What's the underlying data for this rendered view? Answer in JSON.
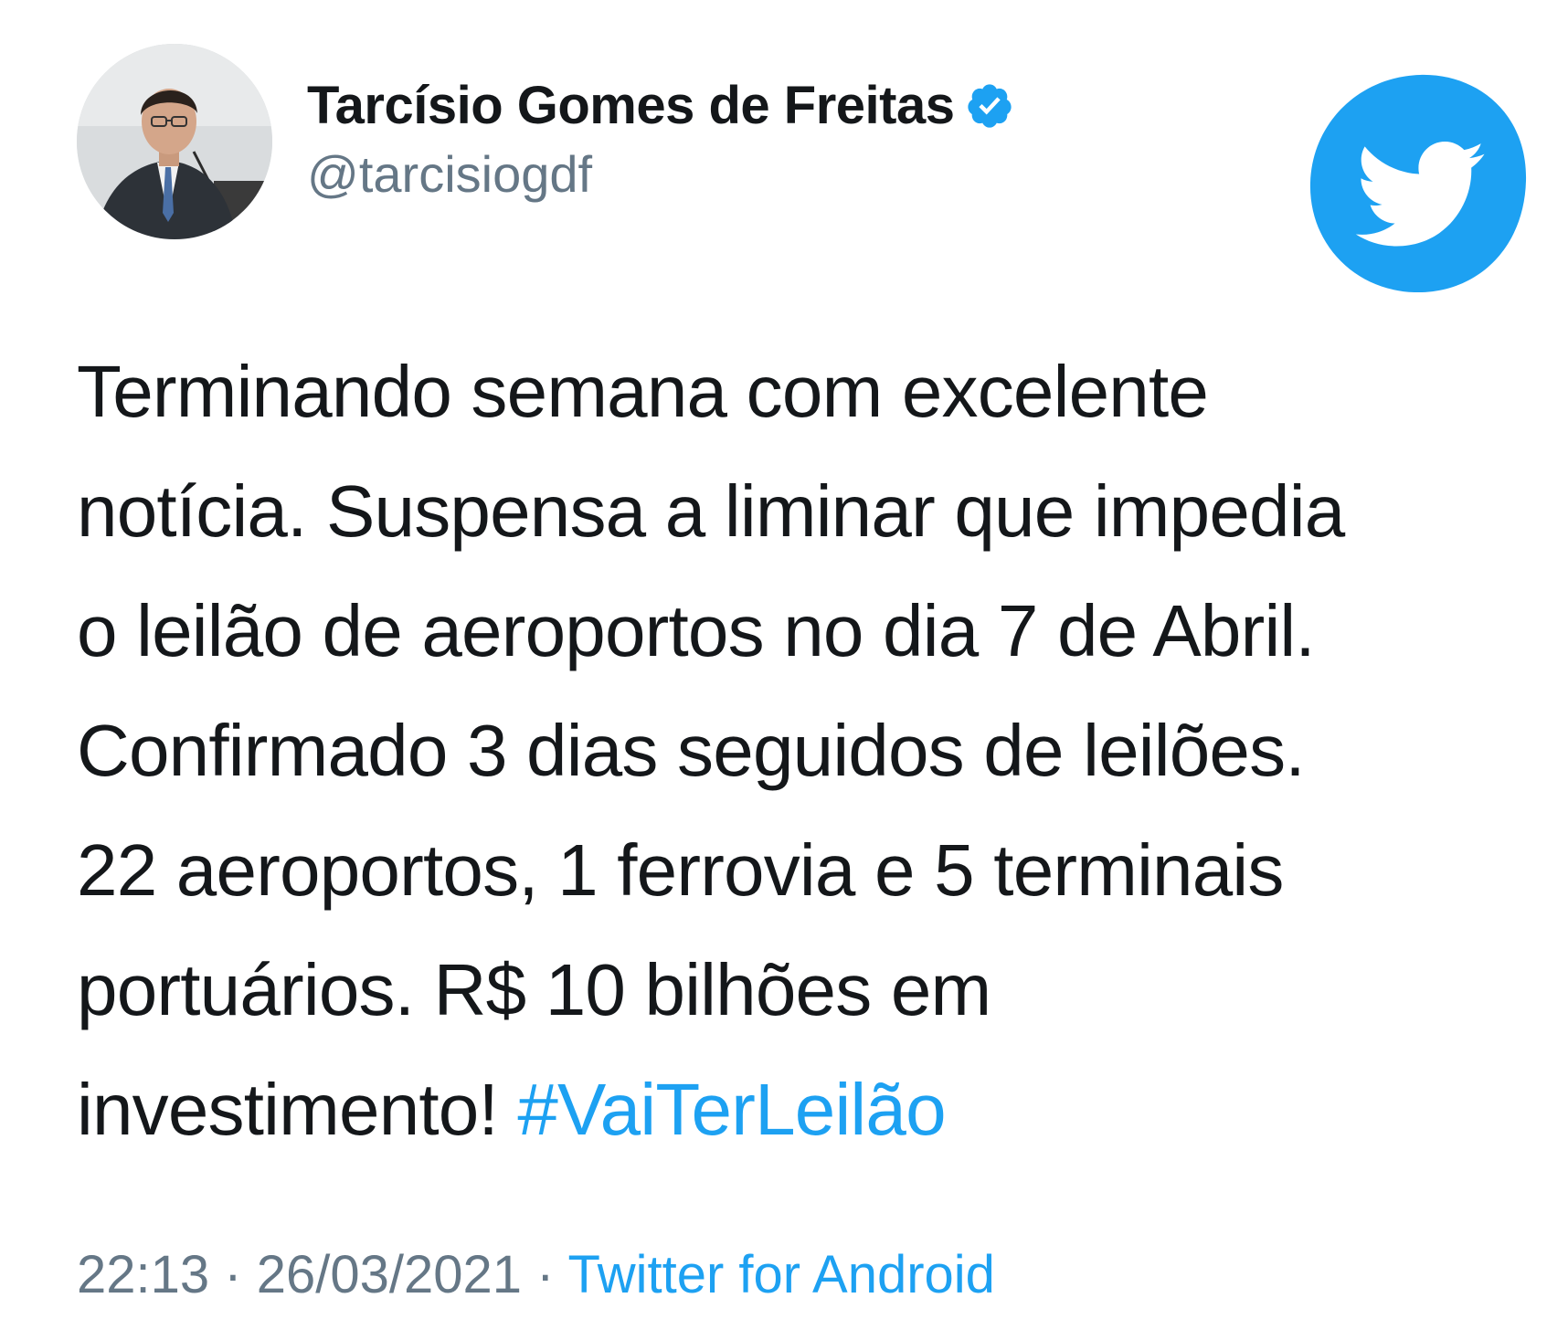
{
  "author": {
    "name": "Tarcísio Gomes de Freitas",
    "handle": "@tarcisiogdf",
    "verified_icon": "verified-badge-icon",
    "avatar_icon": "profile-photo"
  },
  "brand": {
    "logo_icon": "twitter-bird-icon",
    "color": "#1da1f2"
  },
  "tweet": {
    "lines": [
      "Terminando semana com excelente",
      "notícia. Suspensa a liminar que impedia",
      "o leilão de aeroportos no dia 7 de Abril.",
      "Confirmado 3 dias seguidos de leilões.",
      "22 aeroportos, 1 ferrovia e 5 terminais",
      "portuários. R$ 10 bilhões em"
    ],
    "last_line_text": "investimento! ",
    "hashtag": "#VaiTerLeilão"
  },
  "meta": {
    "time": "22:13",
    "separator": " · ",
    "date": "26/03/2021",
    "source": "Twitter for Android"
  },
  "colors": {
    "text": "#14171a",
    "secondary": "#657786",
    "link": "#1da1f2"
  }
}
